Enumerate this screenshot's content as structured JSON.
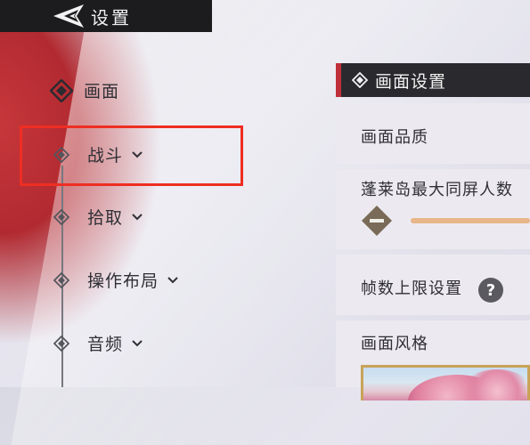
{
  "header": {
    "title": "设置",
    "back_icon": "back-arrow-icon"
  },
  "menu": {
    "items": [
      {
        "label": "画面",
        "icon": "diamond-active-icon",
        "has_chevron": false
      },
      {
        "label": "战斗",
        "icon": "diamond-icon",
        "has_chevron": true
      },
      {
        "label": "拾取",
        "icon": "diamond-icon",
        "has_chevron": true
      },
      {
        "label": "操作布局",
        "icon": "diamond-icon",
        "has_chevron": true
      },
      {
        "label": "音频",
        "icon": "diamond-icon",
        "has_chevron": true
      }
    ]
  },
  "panel": {
    "title": "画面设置",
    "rows": [
      {
        "label": "画面品质"
      },
      {
        "label": "蓬莱岛最大同屏人数"
      },
      {
        "label": "帧数上限设置",
        "help": "?"
      },
      {
        "label": "画面风格"
      }
    ]
  },
  "colors": {
    "accent_red": "#c0303a",
    "highlight_box": "#ee2e22",
    "slider_track": "#e8b589",
    "header_bg": "#1c1c1f"
  }
}
